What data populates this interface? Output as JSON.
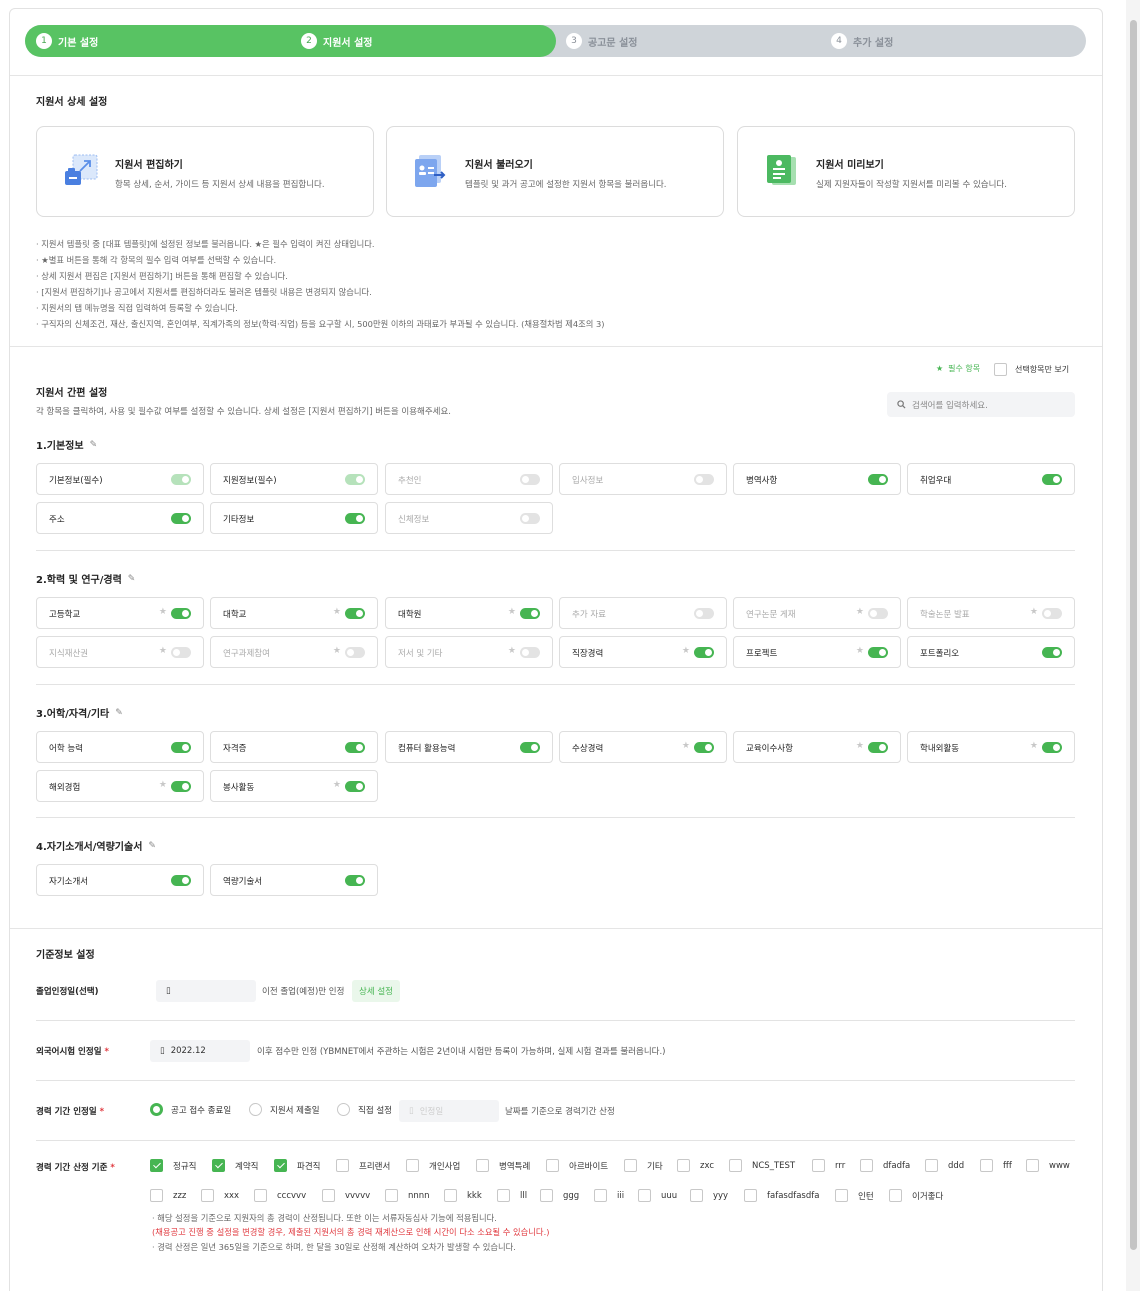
{
  "steps": [
    {
      "num": "1",
      "label": "기본 설정"
    },
    {
      "num": "2",
      "label": "지원서 설정"
    },
    {
      "num": "3",
      "label": "공고문 설정"
    },
    {
      "num": "4",
      "label": "추가 설정"
    }
  ],
  "step_progress": 0.5,
  "detail": {
    "title": "지원서 상세 설정",
    "cards": [
      {
        "title": "지원서 편집하기",
        "desc": "항목 상세, 순서, 가이드 등 지원서 상세 내용을 편집합니다.",
        "icon": "edit-form-icon"
      },
      {
        "title": "지원서 불러오기",
        "desc": "템플릿 및 과거 공고에 설정한 지원서 항목을 불러옵니다.",
        "icon": "import-form-icon"
      },
      {
        "title": "지원서 미리보기",
        "desc": "실제 지원자들이 작성할 지원서를 미리볼 수 있습니다.",
        "icon": "preview-form-icon"
      }
    ],
    "notes": [
      "· 지원서 템플릿 중 [대표 템플릿]에 설정된 정보를 불러옵니다. ★은 필수 입력이 켜진 상태입니다.",
      "· ★별표 버튼을 통해 각 항목의 필수 입력 여부를 선택할 수 있습니다.",
      "· 상세 지원서 편집은 [지원서 편집하기] 버튼을 통해 편집할 수 있습니다.",
      "· [지원서 편집하기]나 공고에서 지원서를 편집하더라도 불러온 템플릿 내용은 변경되지 않습니다.",
      "· 지원서의 탭 메뉴명을 직접 입력하여 등록할 수 있습니다.",
      "· 구직자의 신체조건, 재산, 출신지역, 혼인여부, 직계가족의 정보(학력·직업) 등을 요구할 시, 500만원 이하의 과태료가 부과될 수 있습니다. (채용절차법 제4조의 3)"
    ]
  },
  "simple": {
    "title": "지원서 간편 설정",
    "desc": "각 항목을 클릭하여, 사용 및 필수값 여부를 설정할 수 있습니다. 상세 설정은 [지원서 편집하기] 버튼을 이용해주세요.",
    "legend_required": "필수 항목",
    "legend_selected_only": "선택항목만 보기",
    "search_placeholder": "검색어를 입력하세요.",
    "colors": {
      "accent": "#46b552",
      "accent_light": "#b6e2bb",
      "off": "#e3e3e3"
    },
    "groups": [
      {
        "title": "1.기본정보",
        "items": [
          {
            "label": "기본정보(필수)",
            "state": "locked"
          },
          {
            "label": "지원정보(필수)",
            "state": "locked"
          },
          {
            "label": "추천인",
            "state": "off"
          },
          {
            "label": "입사정보",
            "state": "off"
          },
          {
            "label": "병역사항",
            "state": "on"
          },
          {
            "label": "취업우대",
            "state": "on"
          },
          {
            "label": "주소",
            "state": "on"
          },
          {
            "label": "기타정보",
            "state": "on"
          },
          {
            "label": "신체정보",
            "state": "off"
          }
        ]
      },
      {
        "title": "2.학력 및 연구/경력",
        "items": [
          {
            "label": "고등학교",
            "state": "on",
            "star": true
          },
          {
            "label": "대학교",
            "state": "on",
            "star": true
          },
          {
            "label": "대학원",
            "state": "on",
            "star": true
          },
          {
            "label": "추가 자료",
            "state": "off",
            "star": false
          },
          {
            "label": "연구논문 게재",
            "state": "off",
            "star": true
          },
          {
            "label": "학술논문 발표",
            "state": "off",
            "star": true
          },
          {
            "label": "지식재산권",
            "state": "off",
            "star": true
          },
          {
            "label": "연구과제참여",
            "state": "off",
            "star": true
          },
          {
            "label": "저서 및 기타",
            "state": "off",
            "star": true
          },
          {
            "label": "직장경력",
            "state": "on",
            "star": true
          },
          {
            "label": "프로젝트",
            "state": "on",
            "star": true
          },
          {
            "label": "포트폴리오",
            "state": "on",
            "star": false
          }
        ]
      },
      {
        "title": "3.어학/자격/기타",
        "items": [
          {
            "label": "어학 능력",
            "state": "on",
            "star": false
          },
          {
            "label": "자격증",
            "state": "on",
            "star": false
          },
          {
            "label": "컴퓨터 활용능력",
            "state": "on",
            "star": false
          },
          {
            "label": "수상경력",
            "state": "on",
            "star": true
          },
          {
            "label": "교육이수사항",
            "state": "on",
            "star": true
          },
          {
            "label": "학내외활동",
            "state": "on",
            "star": true
          },
          {
            "label": "해외경험",
            "state": "on",
            "star": true
          },
          {
            "label": "봉사활동",
            "state": "on",
            "star": true
          }
        ]
      },
      {
        "title": "4.자기소개서/역량기술서",
        "items": [
          {
            "label": "자기소개서",
            "state": "on",
            "star": false
          },
          {
            "label": "역량기술서",
            "state": "on",
            "star": false
          }
        ]
      }
    ]
  },
  "criteria": {
    "title": "기준정보 설정",
    "graduation": {
      "label": "졸업인정일(선택)",
      "date": "",
      "suffix": "이전 졸업(예정)만 인정",
      "button": "상세 설정"
    },
    "foreign": {
      "label": "외국어시험 인정일",
      "req": "*",
      "date": "2022.12",
      "suffix": "이후 점수만 인정 (YBMNET에서 주관하는 시험은 2년이내 시험만 등록이 가능하며, 실제 시험 결과를 불러옵니다.)"
    },
    "career_date": {
      "label": "경력 기간 인정일",
      "req": "*",
      "options": [
        {
          "label": "공고 접수 종료일",
          "selected": true
        },
        {
          "label": "지원서 제출일",
          "selected": false
        },
        {
          "label": "직접 설정",
          "selected": false
        }
      ],
      "date_placeholder": "인정일",
      "suffix": "날짜를 기준으로 경력기간 산정"
    },
    "career_basis": {
      "label": "경력 기간 산정 기준",
      "req": "*",
      "row1": [
        {
          "label": "정규직",
          "checked": true
        },
        {
          "label": "계약직",
          "checked": true
        },
        {
          "label": "파견직",
          "checked": true
        },
        {
          "label": "프리랜서",
          "checked": false
        },
        {
          "label": "개인사업",
          "checked": false
        },
        {
          "label": "병역특례",
          "checked": false
        },
        {
          "label": "아르바이트",
          "checked": false
        },
        {
          "label": "기타",
          "checked": false
        },
        {
          "label": "zxc",
          "checked": false
        },
        {
          "label": "NCS_TEST",
          "checked": false
        },
        {
          "label": "rrr",
          "checked": false
        },
        {
          "label": "dfadfa",
          "checked": false
        },
        {
          "label": "ddd",
          "checked": false
        },
        {
          "label": "fff",
          "checked": false
        },
        {
          "label": "www",
          "checked": false
        }
      ],
      "row2": [
        {
          "label": "zzz",
          "checked": false
        },
        {
          "label": "xxx",
          "checked": false
        },
        {
          "label": "cccvvv",
          "checked": false
        },
        {
          "label": "vvvvv",
          "checked": false
        },
        {
          "label": "nnnn",
          "checked": false
        },
        {
          "label": "kkk",
          "checked": false
        },
        {
          "label": "lll",
          "checked": false
        },
        {
          "label": "ggg",
          "checked": false
        },
        {
          "label": "iii",
          "checked": false
        },
        {
          "label": "uuu",
          "checked": false
        },
        {
          "label": "yyy",
          "checked": false
        },
        {
          "label": "fafasdfasdfa",
          "checked": false
        },
        {
          "label": "인턴",
          "checked": false
        },
        {
          "label": "이거좋다",
          "checked": false
        }
      ],
      "notes": [
        "· 해당 설정을 기준으로 지원자의 총 경력이 산정됩니다. 또한 이는 서류자동심사 기능에 적용됩니다.",
        "(채용공고 진행 중 설정을 변경할 경우, 제출된 지원서의 총 경력 재계산으로 인해 시간이 다소 소요될 수 있습니다.)",
        "· 경력 산정은 일년 365일을 기준으로 하며, 한 달을 30일로 산정해 계산하여 오차가 발생할 수 있습니다."
      ]
    }
  }
}
